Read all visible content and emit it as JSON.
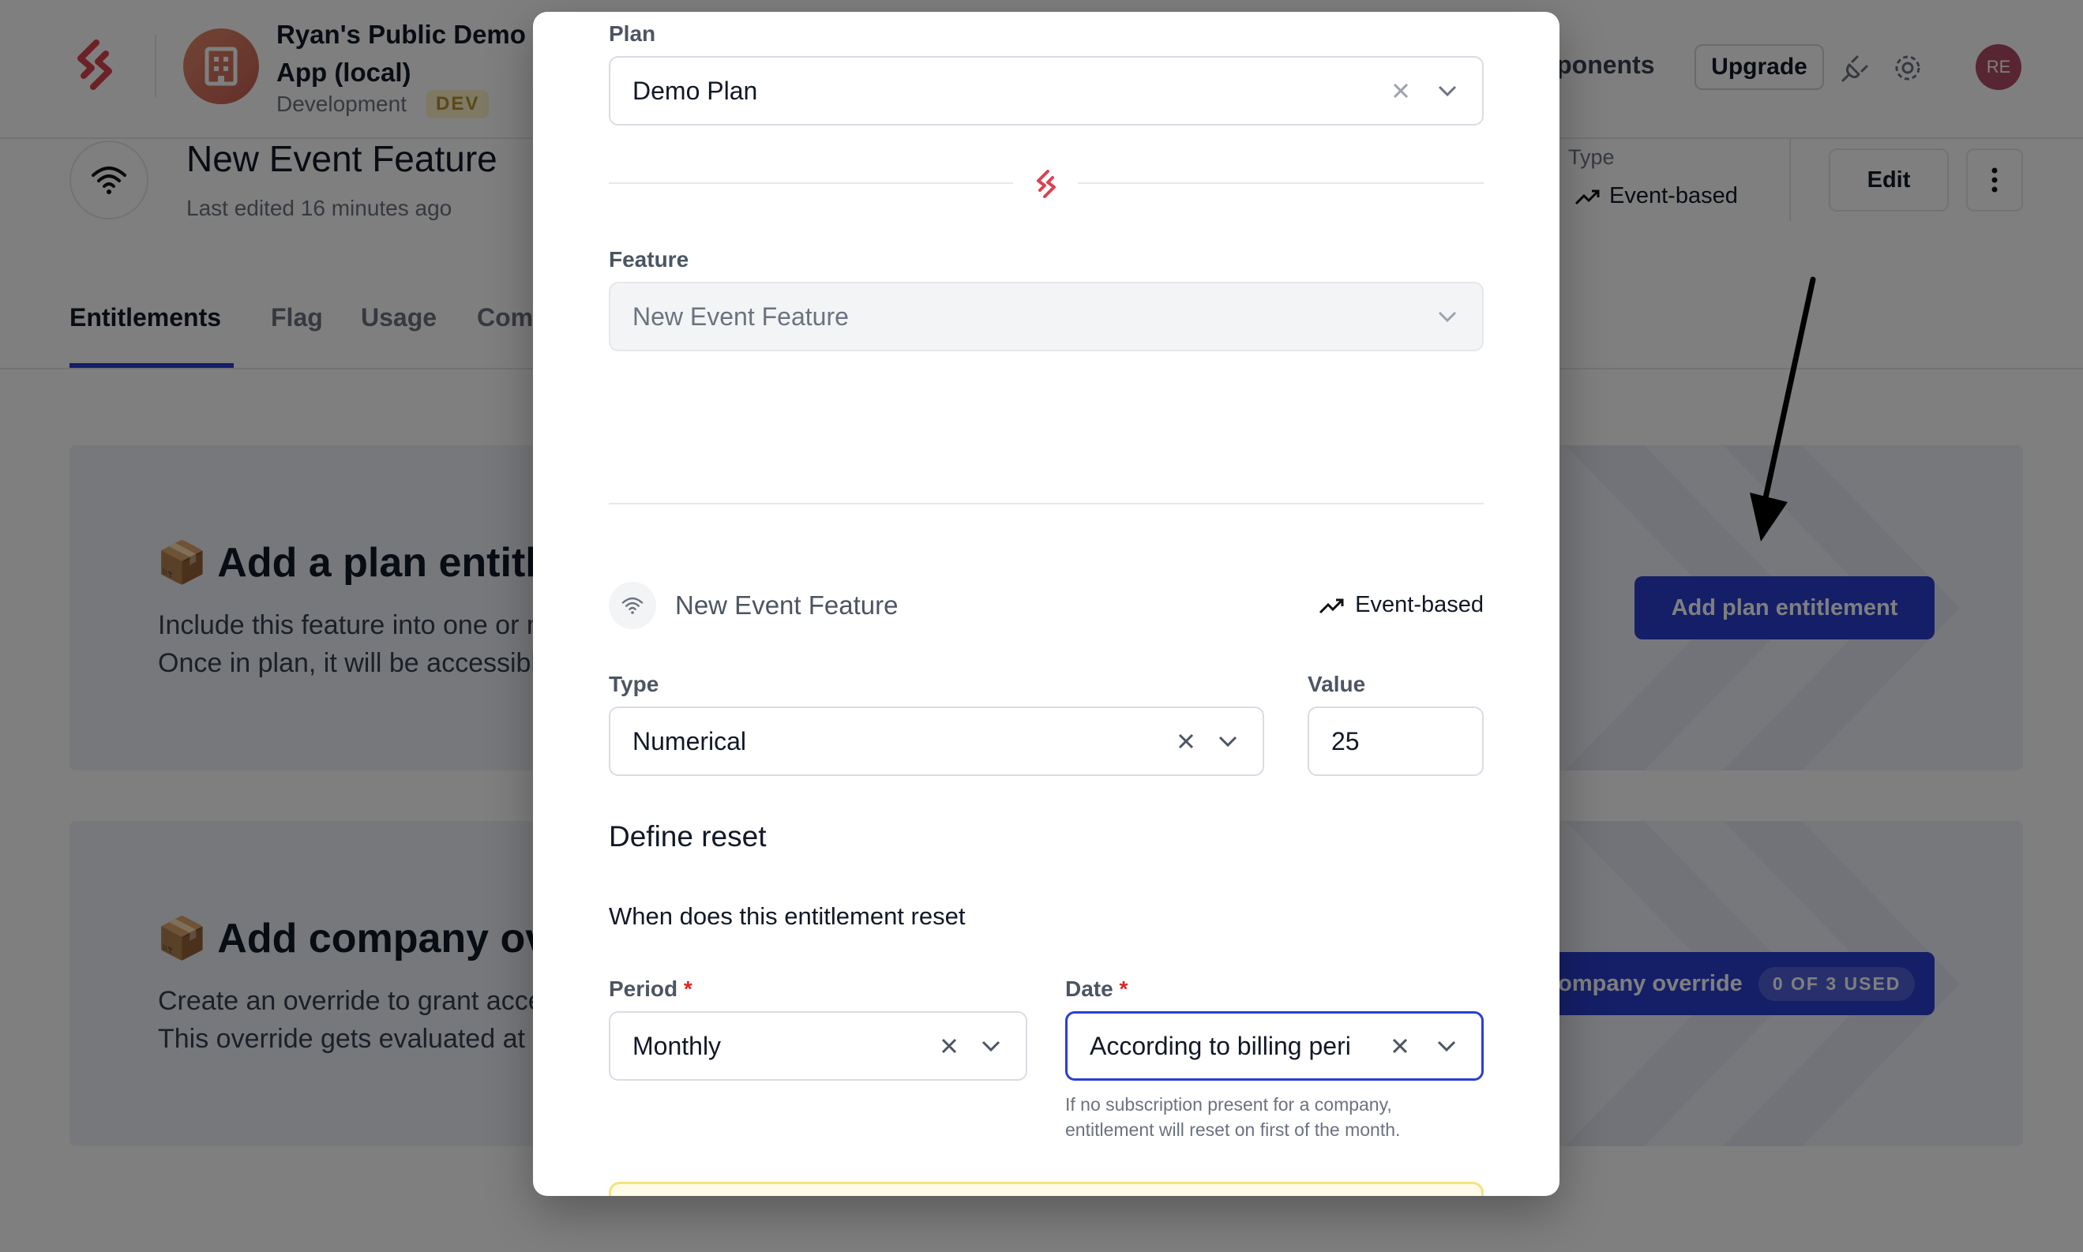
{
  "app": {
    "name": "Ryan's Public Demo App (local)",
    "environment": "Development",
    "env_badge": "DEV",
    "nav_components": "Components",
    "upgrade_label": "Upgrade",
    "user_initials": "RE"
  },
  "feature": {
    "title": "New Event Feature",
    "last_edited": "Last edited 16 minutes ago",
    "type_label": "Type",
    "type_value": "Event-based",
    "edit_label": "Edit"
  },
  "tabs": [
    {
      "label": "Entitlements",
      "active": true
    },
    {
      "label": "Flag",
      "active": false
    },
    {
      "label": "Usage",
      "active": false
    },
    {
      "label": "Companies",
      "active": false
    }
  ],
  "cards": {
    "plan": {
      "title": "📦 Add a plan entitlement",
      "line1": "Include this feature into one or more plans.",
      "line2": "Once in plan, it will be accessible to companies on that plan.",
      "button": "Add plan entitlement"
    },
    "override": {
      "title": "📦 Add company override",
      "line1": "Create an override to grant access to a company.",
      "line2": "This override gets evaluated at a higher priority.",
      "button": "Add company override",
      "badge": "0 OF 3 USED"
    }
  },
  "modal": {
    "plan_label": "Plan",
    "plan_value": "Demo Plan",
    "feature_label": "Feature",
    "feature_value": "New Event Feature",
    "feature_row_name": "New Event Feature",
    "feature_row_type": "Event-based",
    "type_label": "Type",
    "type_value": "Numerical",
    "value_label": "Value",
    "value_value": "25",
    "reset_heading": "Define reset",
    "reset_question": "When does this entitlement reset",
    "period_label": "Period",
    "period_value": "Monthly",
    "date_label": "Date",
    "date_value": "According to billing period",
    "required_mark": "*",
    "date_hint_1": "If no subscription present for a company,",
    "date_hint_2": "entitlement will reset on first of the month."
  },
  "colors": {
    "accent": "#2b3fd1",
    "brand": "#d9434f",
    "dev_badge_bg": "#fdf3c7",
    "focus_border": "#2b3fd1"
  }
}
